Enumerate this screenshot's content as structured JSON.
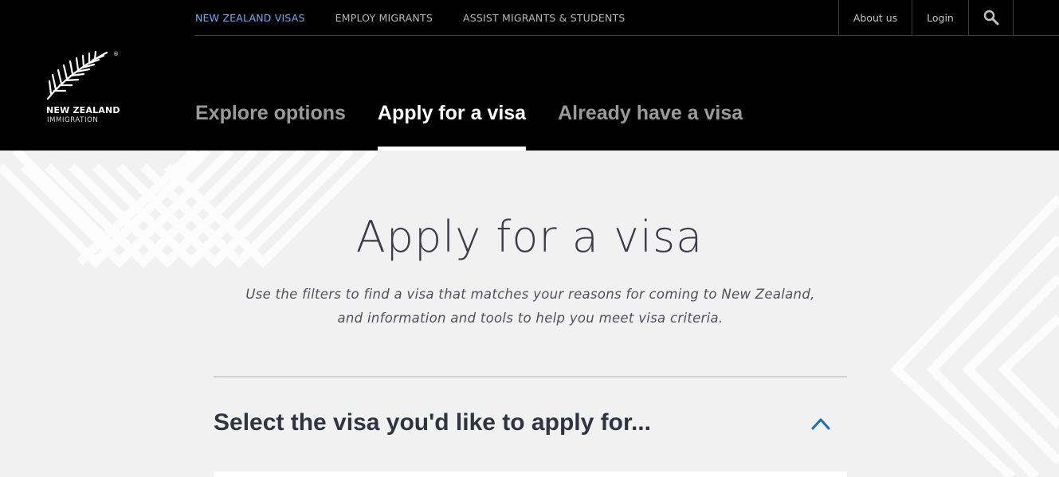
{
  "logo": {
    "line1": "NEW ZEALAND",
    "line2": "IMMIGRATION",
    "reg": "®"
  },
  "topnav": {
    "items": [
      {
        "label": "NEW ZEALAND VISAS",
        "active": true
      },
      {
        "label": "EMPLOY MIGRANTS",
        "active": false
      },
      {
        "label": "ASSIST MIGRANTS & STUDENTS",
        "active": false
      }
    ]
  },
  "utility": {
    "about": "About us",
    "login": "Login",
    "search_icon": "search-icon"
  },
  "mainnav": {
    "tabs": [
      {
        "label": "Explore options",
        "active": false
      },
      {
        "label": "Apply for a visa",
        "active": true
      },
      {
        "label": "Already have a visa",
        "active": false
      }
    ]
  },
  "main": {
    "title": "Apply for a visa",
    "intro": "Use the filters to find a visa that matches your reasons for coming to New Zealand, and information and tools to help you meet visa criteria.",
    "select_heading": "Select the visa you'd like to apply for...",
    "chevron_icon": "chevron-up-icon"
  },
  "colors": {
    "header_bg": "#000000",
    "active_link": "#6aaef5",
    "accent": "#1e6fb8",
    "page_bg": "#f1f1f1"
  }
}
